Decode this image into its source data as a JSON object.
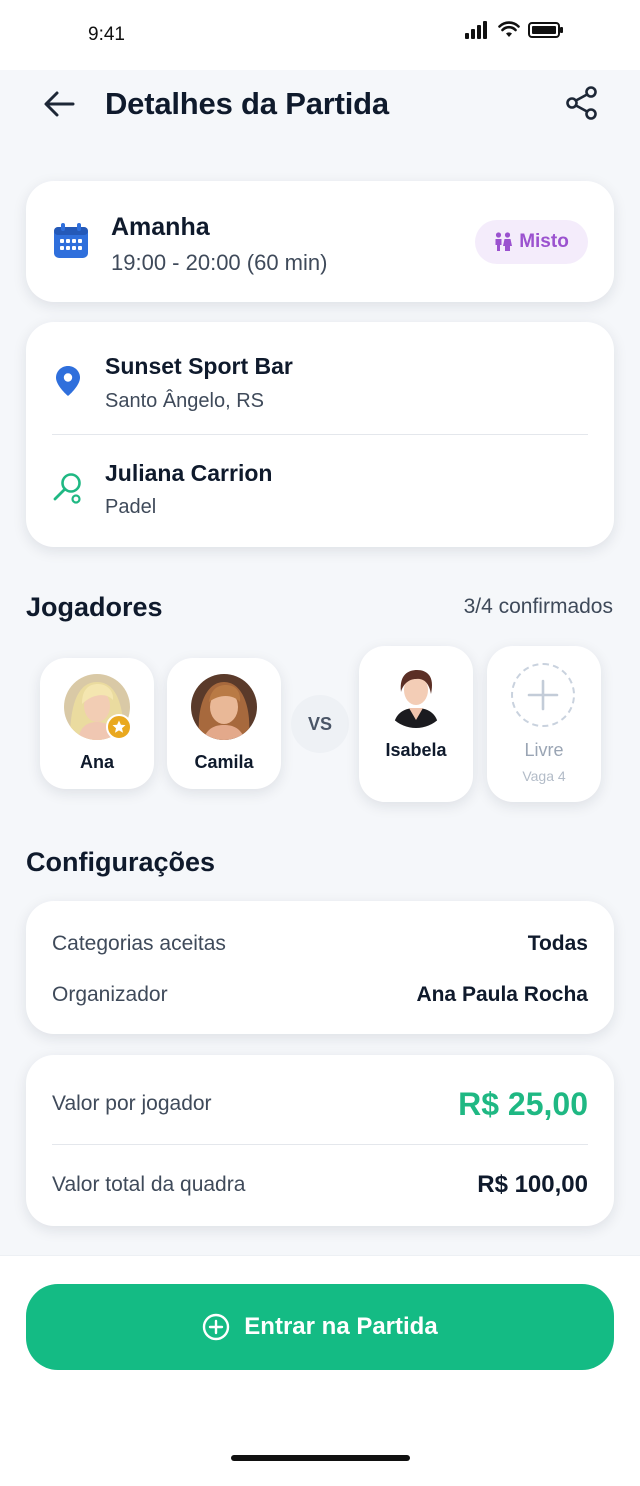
{
  "status_bar": {
    "time": "9:41"
  },
  "header": {
    "title": "Detalhes da Partida"
  },
  "schedule": {
    "day": "Amanha",
    "time_range": "19:00 - 20:00 (60 min)",
    "badge": "Misto"
  },
  "venue": {
    "name": "Sunset Sport Bar",
    "location": "Santo Ângelo, RS"
  },
  "coach": {
    "name": "Juliana Carrion",
    "sport": "Padel"
  },
  "players": {
    "section_title": "Jogadores",
    "count": "3/4 confirmados",
    "vs": "VS",
    "list": [
      {
        "name": "Ana",
        "organizer": true
      },
      {
        "name": "Camila"
      },
      {
        "name": "Isabela"
      }
    ],
    "free_slot": {
      "label": "Livre",
      "sub": "Vaga 4"
    }
  },
  "settings": {
    "section_title": "Configurações",
    "rows": [
      {
        "label": "Categorias aceitas",
        "value": "Todas"
      },
      {
        "label": "Organizador",
        "value": "Ana Paula Rocha"
      }
    ]
  },
  "pricing": {
    "per_player_label": "Valor por jogador",
    "per_player_value": "R$ 25,00",
    "total_label": "Valor total da quadra",
    "total_value": "R$ 100,00"
  },
  "cta": {
    "label": "Entrar na Partida"
  },
  "colors": {
    "accent_green": "#14bb84",
    "price_green": "#1fb883",
    "badge_purple": "#9b52cf",
    "icon_blue": "#2f6fdc",
    "star_gold": "#e9a81f"
  }
}
